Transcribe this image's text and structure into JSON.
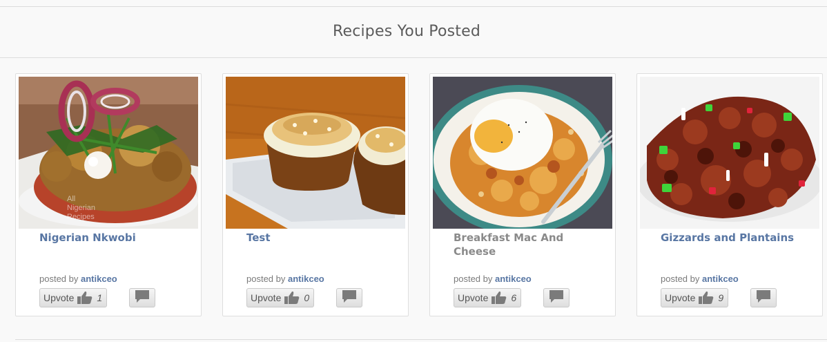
{
  "section": {
    "title": "Recipes You Posted"
  },
  "cards": [
    {
      "title": "Nigerian Nkwobi",
      "posted_prefix": "posted by",
      "author": "antikceo",
      "upvote_label": "Upvote",
      "votes": "1",
      "image": "nkwobi-bowl-photo",
      "watermark": "All Nigerian Recipes"
    },
    {
      "title": "Test",
      "posted_prefix": "posted by",
      "author": "antikceo",
      "upvote_label": "Upvote",
      "votes": "0",
      "image": "muffins-photo"
    },
    {
      "title": "Breakfast Mac And Cheese",
      "posted_prefix": "posted by",
      "author": "antikceo",
      "upvote_label": "Upvote",
      "votes": "6",
      "image": "mac-and-cheese-egg-photo"
    },
    {
      "title": "Gizzards and Plantains",
      "posted_prefix": "posted by",
      "author": "antikceo",
      "upvote_label": "Upvote",
      "votes": "9",
      "image": "gizzards-photo"
    }
  ],
  "colors": {
    "link": "#5876a3",
    "muted_title": "#8a8a8a",
    "heading": "#5b5b5b"
  },
  "icons": [
    "thumbs-up-icon",
    "comment-bubble-icon"
  ]
}
